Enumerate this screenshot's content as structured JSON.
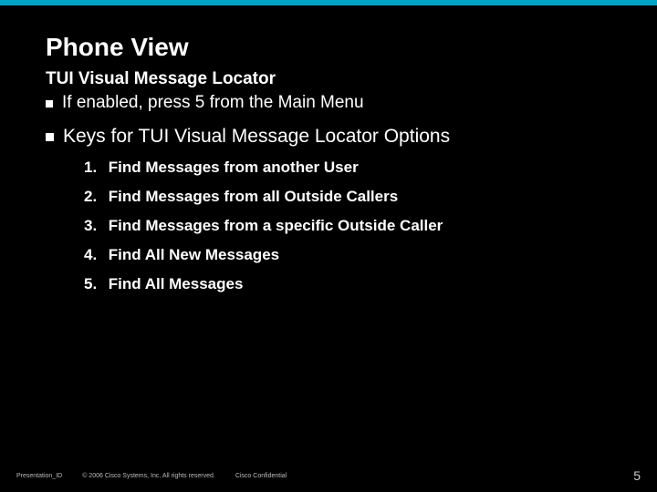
{
  "title": "Phone View",
  "subtitle": "TUI Visual Message Locator",
  "bullet1": "If enabled, press 5 from the Main Menu",
  "bullet2": "Keys for TUI Visual Message Locator Options",
  "items": [
    {
      "num": "1.",
      "text": "Find Messages from another User"
    },
    {
      "num": "2.",
      "text": "Find Messages from all Outside Callers"
    },
    {
      "num": "3.",
      "text": "Find Messages from a specific Outside Caller"
    },
    {
      "num": "4.",
      "text": "Find All New Messages"
    },
    {
      "num": "5.",
      "text": "Find All Messages"
    }
  ],
  "footer": {
    "presentation_id": "Presentation_ID",
    "copyright": "© 2006 Cisco Systems, Inc. All rights reserved.",
    "confidential": "Cisco Confidential",
    "page": "5"
  }
}
